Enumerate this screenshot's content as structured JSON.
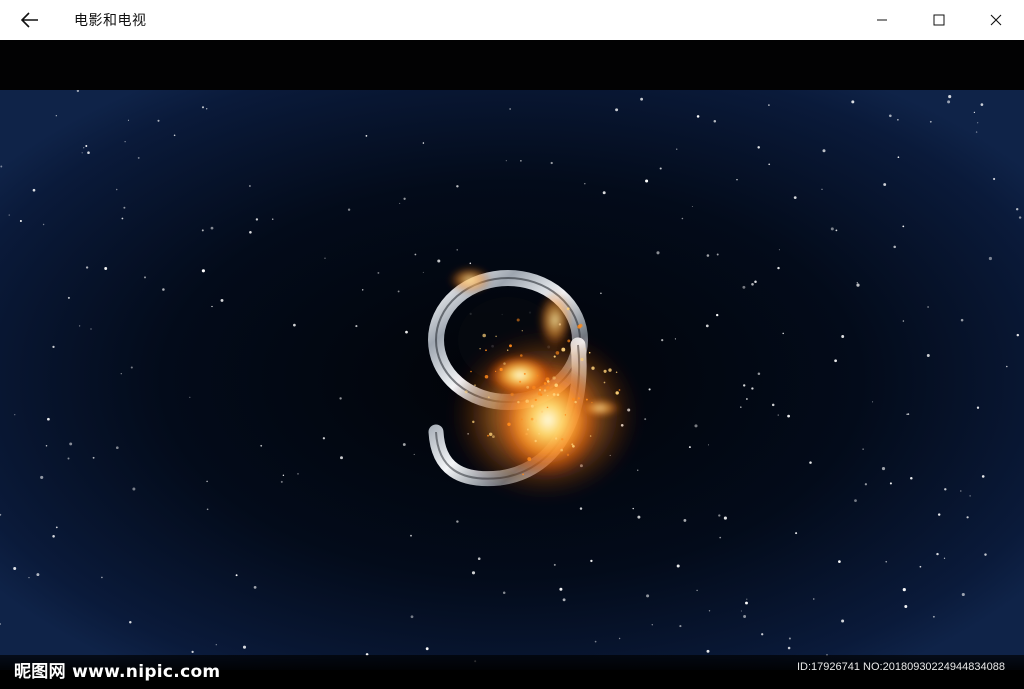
{
  "titlebar": {
    "app_title": "电影和电视",
    "back_icon": "back-arrow-icon",
    "minimize_icon": "minimize-icon",
    "maximize_icon": "maximize-icon",
    "close_icon": "close-icon"
  },
  "video": {
    "countdown_digit": "9",
    "watermark_logo": "昵图网 www.nipic.com",
    "watermark_id": "ID:17926741 NO:20180930224944834088"
  },
  "colors": {
    "titlebar_bg": "#ffffff",
    "space_center": "#010307",
    "space_edge": "#0f2348",
    "fire_core": "#fff4c0",
    "fire_orange": "#ff8a1a",
    "chrome": "#d9dde3"
  }
}
